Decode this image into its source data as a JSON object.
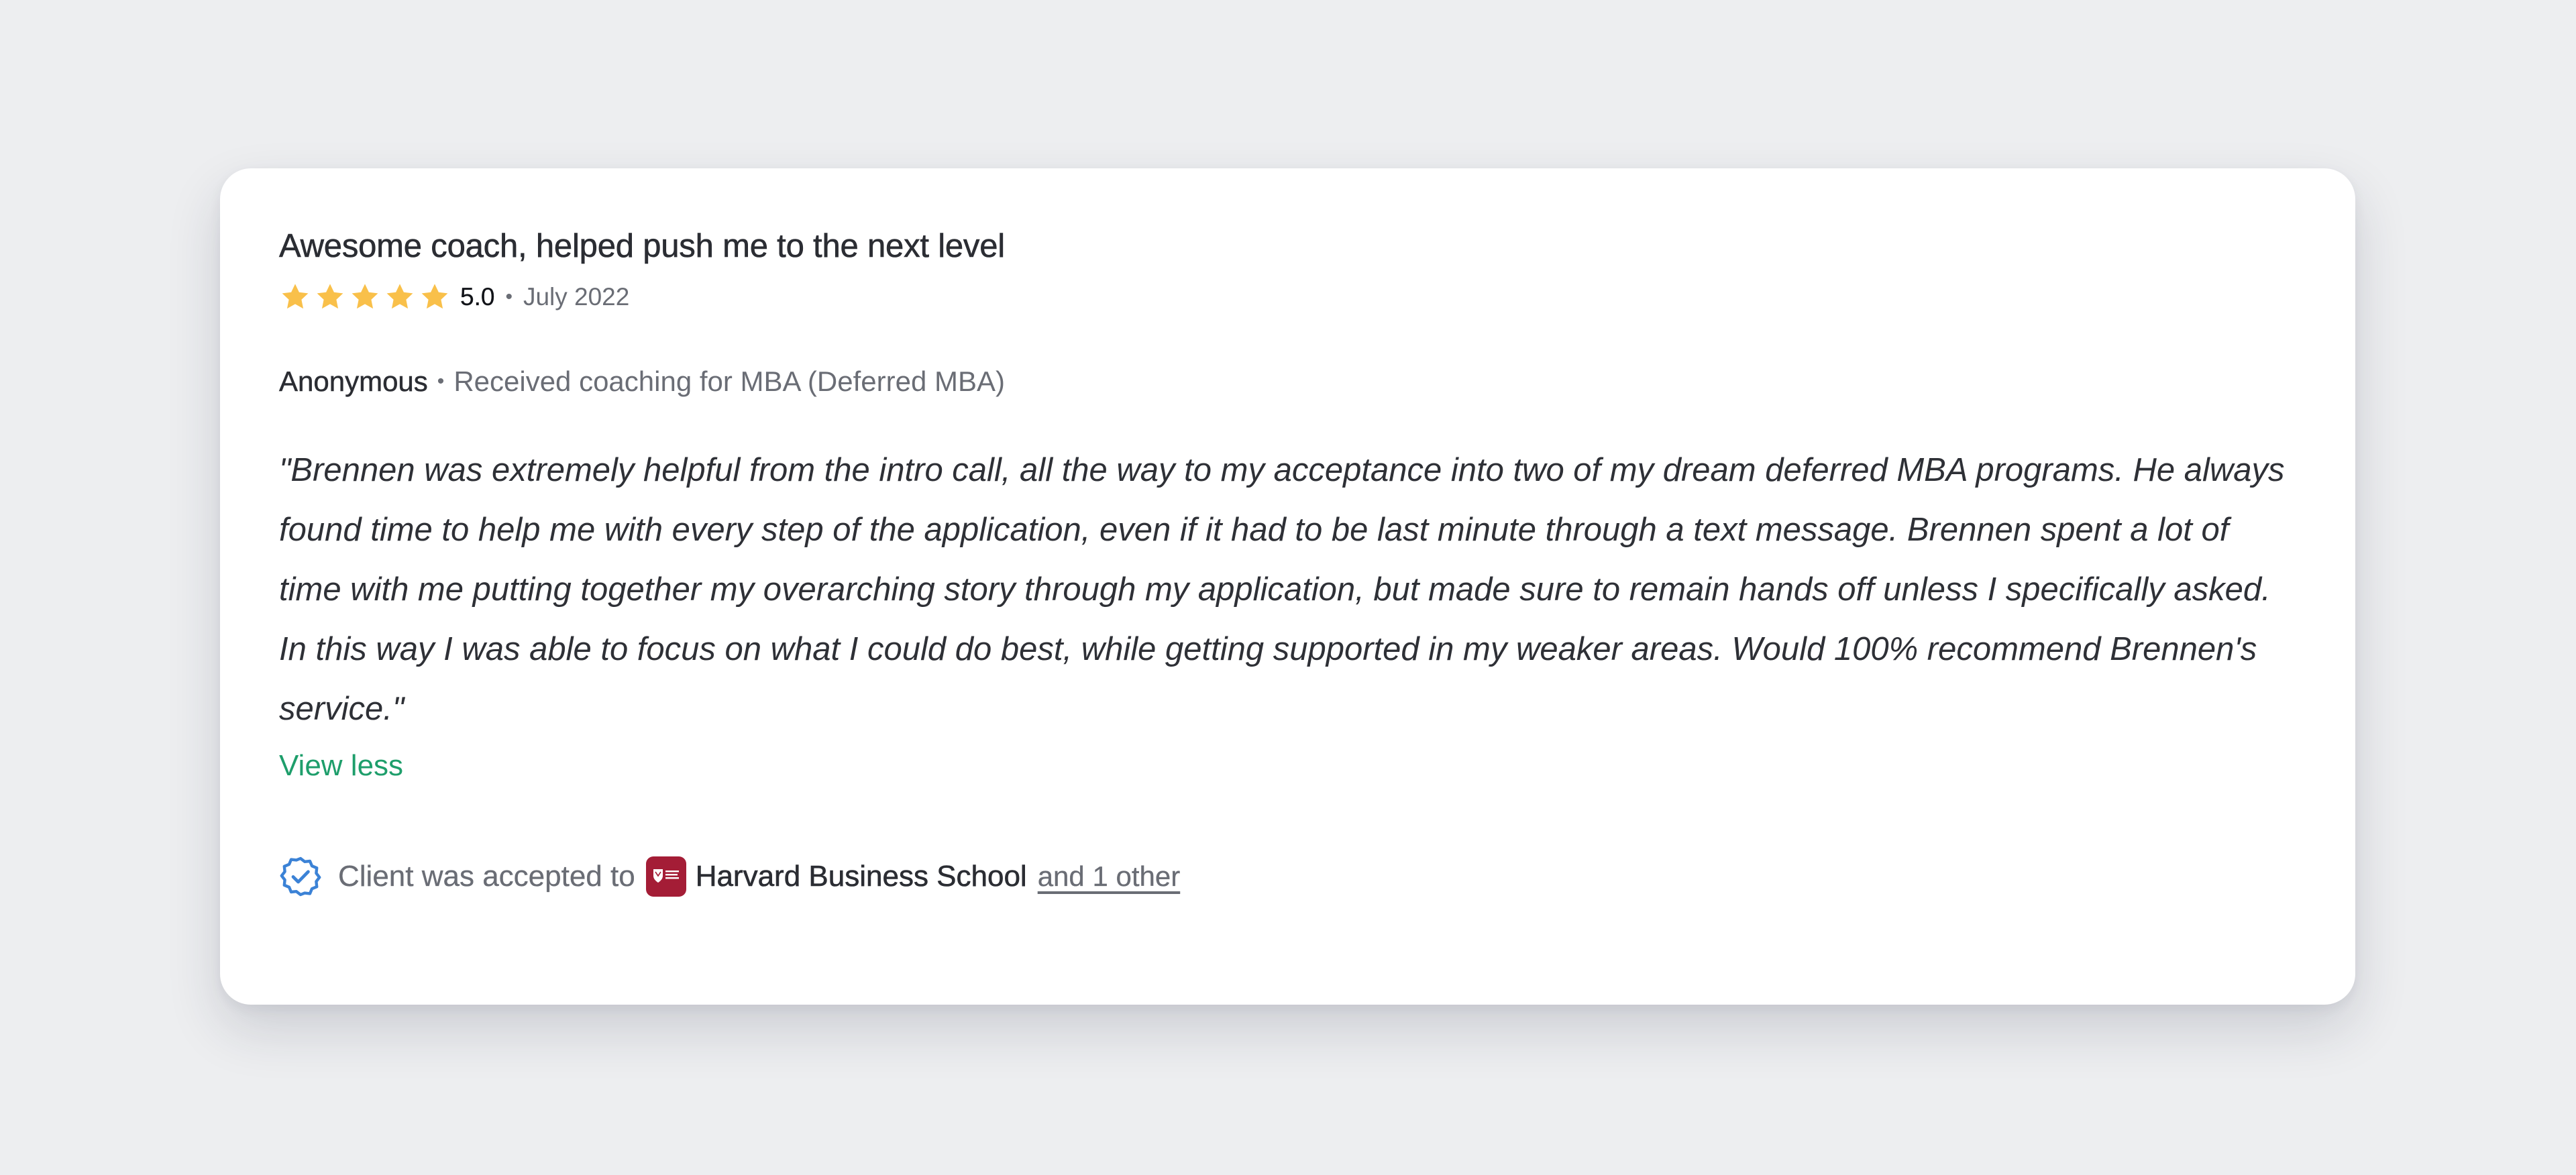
{
  "review": {
    "title": "Awesome coach, helped push me to the next level",
    "rating": {
      "stars": 5,
      "max_stars": 5,
      "value_label": "5.0",
      "separator": "•",
      "date": "July 2022",
      "star_color": "#f9c04a",
      "star_icon": "star-icon"
    },
    "author": {
      "name": "Anonymous",
      "separator": "•",
      "coaching_label": "Received coaching for MBA (Deferred MBA)"
    },
    "quote": "\"Brennen was extremely helpful from the intro call, all the way to my acceptance into two of my dream deferred MBA programs. He always found time to help me with every step of the application, even if it had to be last minute through a text message. Brennen spent a lot of time with me putting together my overarching story through my application, but made sure to remain hands off unless I specifically asked. In this way I was able to focus on what I could do best, while getting supported in my weaker areas. Would 100% recommend Brennen's service.\"",
    "view_less_label": "View less",
    "accepted": {
      "icon": "verified-badge-icon",
      "text": "Client was accepted to",
      "school_logo_icon": "harvard-shield-icon",
      "school_logo_color": "#a41d36",
      "school_name": "Harvard Business School",
      "others_link": "and 1 other"
    }
  },
  "colors": {
    "background": "#edeef0",
    "card": "#ffffff",
    "link_green": "#1e9e6b",
    "verified_blue": "#3b82d6"
  }
}
